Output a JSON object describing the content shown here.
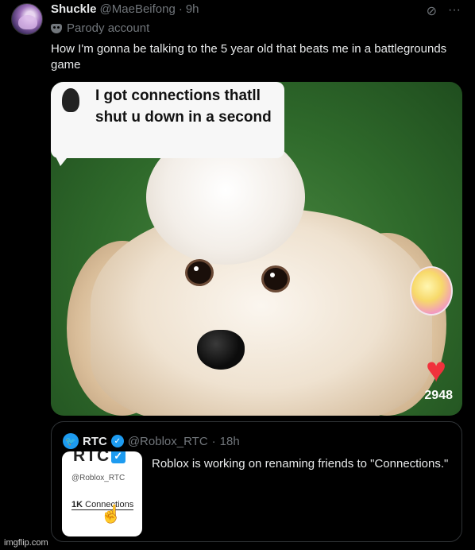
{
  "tweet": {
    "display_name": "Shuckle",
    "handle": "@MaeBeifong",
    "separator": "·",
    "time": "9h",
    "parody_label": "Parody account",
    "text": "How I'm gonna be talking to the 5 year old that beats me in a battlegrounds game"
  },
  "media": {
    "caption": "I got connections thatll shut u down in a second",
    "likes": "2948"
  },
  "quote": {
    "display_name": "RTC",
    "handle": "@Roblox_RTC",
    "separator": "·",
    "time": "18h",
    "text": "Roblox is working on renaming friends to \"Connections.\"",
    "thumb": {
      "logo": "RTC",
      "handle": "@Roblox_RTC",
      "count": "1K",
      "label": "Connections"
    }
  },
  "icons": {
    "grok": "grok-icon",
    "more": "more-icon",
    "parody": "mask-icon",
    "verified": "verified-icon",
    "heart": "heart-icon",
    "cursor": "hand-pointer-icon"
  },
  "colors": {
    "background": "#000000",
    "text": "#e7e9ea",
    "secondary": "#71767b",
    "accent": "#1d9bf0",
    "heart": "#f0323c"
  },
  "watermark": "imgflip.com"
}
